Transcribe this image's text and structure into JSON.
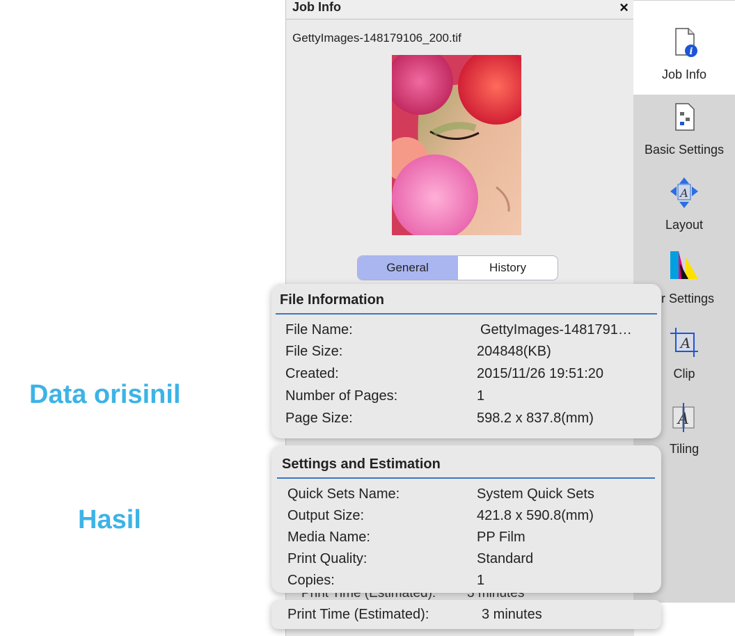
{
  "callouts": {
    "original": "Data orisinil",
    "result": "Hasil"
  },
  "panel": {
    "title": "Job Info",
    "close": "×",
    "filename": "GettyImages-148179106_200.tif",
    "tabs": [
      {
        "label": "General",
        "active": true
      },
      {
        "label": "History",
        "active": false
      }
    ]
  },
  "nav": {
    "items": [
      {
        "label": "Job Info",
        "icon": "job-info-icon",
        "active": true
      },
      {
        "label": "Basic Settings",
        "icon": "basic-settings-icon"
      },
      {
        "label": "Layout",
        "icon": "layout-icon"
      },
      {
        "label": "or Settings",
        "icon": "color-settings-icon"
      },
      {
        "label": "Clip",
        "icon": "clip-icon"
      },
      {
        "label": "Tiling",
        "icon": "tiling-icon"
      }
    ]
  },
  "file_info": {
    "title": "File Information",
    "rows": [
      {
        "label": "File Name:",
        "value": "GettyImages-1481791…"
      },
      {
        "label": "File Size:",
        "value": "204848(KB)"
      },
      {
        "label": "Created:",
        "value": "2015/11/26 19:51:20"
      },
      {
        "label": "Number of Pages:",
        "value": "1"
      },
      {
        "label": "Page Size:",
        "value": "598.2 x 837.8(mm)"
      }
    ]
  },
  "settings": {
    "title": "Settings and Estimation",
    "rows": [
      {
        "label": "Quick Sets Name:",
        "value": "System Quick Sets"
      },
      {
        "label": "Output Size:",
        "value": "421.8 x 590.8(mm)"
      },
      {
        "label": "Media Name:",
        "value": "PP Film"
      },
      {
        "label": "Print Quality:",
        "value": "Standard"
      },
      {
        "label": "Copies:",
        "value": "1"
      }
    ]
  },
  "behind": {
    "label": "Print Time (Estimated):",
    "value": "3 minutes"
  },
  "print_time": {
    "label": "Print Time (Estimated):",
    "value": "3 minutes"
  },
  "colors": {
    "accent": "#3b76c4",
    "callout": "#3db3e6",
    "tab_active": "#a9b6f0"
  }
}
